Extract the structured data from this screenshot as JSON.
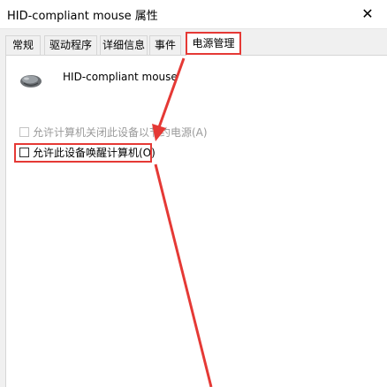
{
  "window": {
    "title": "HID-compliant mouse 属性",
    "close_glyph": "✕"
  },
  "tabs": [
    {
      "label": "常规",
      "active": false
    },
    {
      "label": "驱动程序",
      "active": false
    },
    {
      "label": "详细信息",
      "active": false
    },
    {
      "label": "事件",
      "active": false
    },
    {
      "label": "电源管理",
      "active": true
    }
  ],
  "device": {
    "name": "HID-compliant mouse",
    "icon": "mouse-icon"
  },
  "power_options": [
    {
      "label": "允许计算机关闭此设备以节约电源(A)",
      "checked": false,
      "enabled": false
    },
    {
      "label": "允许此设备唤醒计算机(O)",
      "checked": false,
      "enabled": true
    }
  ],
  "annotation": {
    "color": "#e53935"
  }
}
